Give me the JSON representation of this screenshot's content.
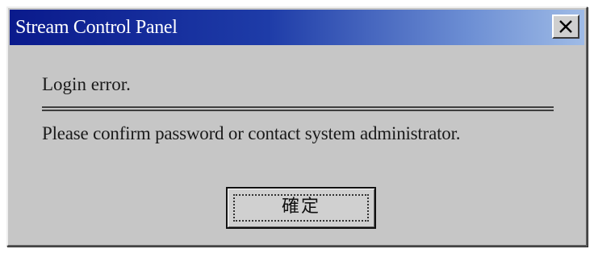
{
  "window": {
    "title": "Stream Control Panel",
    "close_icon": "close-icon"
  },
  "message": {
    "line1": "Login error.",
    "line2": "Please confirm password or contact system administrator."
  },
  "buttons": {
    "ok_label": "確定"
  },
  "colors": {
    "titlebar_start": "#0a1a8c",
    "titlebar_end": "#9fbbe6",
    "dialog_background": "#c6c6c6"
  }
}
